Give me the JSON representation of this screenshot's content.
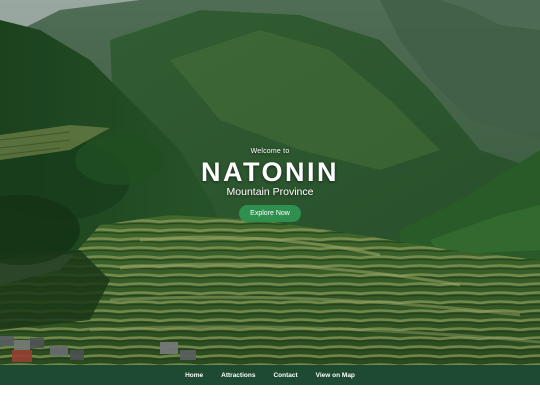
{
  "hero": {
    "welcome": "Welcome to",
    "title": "NATONIN",
    "subtitle": "Mountain Province",
    "cta_label": "Explore Now"
  },
  "nav": {
    "items": [
      {
        "label": "Home"
      },
      {
        "label": "Attractions"
      },
      {
        "label": "Contact"
      },
      {
        "label": "View on Map"
      }
    ]
  },
  "colors": {
    "nav_background": "#1e4a31",
    "cta_background": "#2e8f4e",
    "text": "#ffffff"
  }
}
